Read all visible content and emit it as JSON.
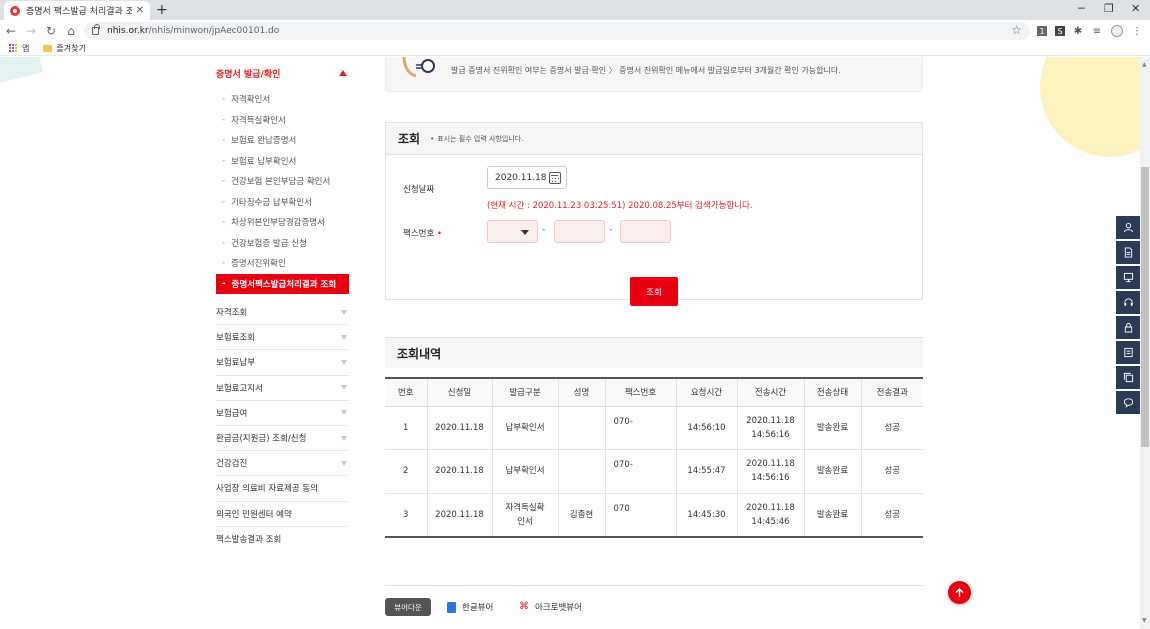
{
  "browser": {
    "tab_title": "증명서 팩스발급 처리결과 조회",
    "url_domain": "nhis.or.kr",
    "url_path": "/nhis/minwon/jpAec00101.do",
    "bookmarks": [
      {
        "label": "앱"
      },
      {
        "label": "즐겨찾기"
      }
    ]
  },
  "sidebar": {
    "active_section": "증명서 발급/확인",
    "sub_items": [
      {
        "label": "자격확인서",
        "active": false
      },
      {
        "label": "자격득실확인서",
        "active": false
      },
      {
        "label": "보험료 완납증명서",
        "active": false
      },
      {
        "label": "보험료 납부확인서",
        "active": false
      },
      {
        "label": "건강보험 본인부담금 확인서",
        "active": false
      },
      {
        "label": "기타징수금 납부확인서",
        "active": false
      },
      {
        "label": "차상위본인부담경감증명서",
        "active": false
      },
      {
        "label": "건강보험증 발급 신청",
        "active": false
      },
      {
        "label": "증명서진위확인",
        "active": false
      },
      {
        "label": "증명서팩스발급처리결과 조회",
        "active": true
      }
    ],
    "menu_items": [
      {
        "label": "자격조회"
      },
      {
        "label": "보험료조회"
      },
      {
        "label": "보험료납부"
      },
      {
        "label": "보험료고지서"
      },
      {
        "label": "보험급여"
      },
      {
        "label": "환급금(지원금) 조회/신청"
      },
      {
        "label": "건강검진"
      },
      {
        "label": "사업장 의료비 자료제공 동의"
      },
      {
        "label": "외국인 민원센터 예약"
      },
      {
        "label": "팩스발송결과 조회"
      }
    ]
  },
  "notice": {
    "text": "발급 증명서 진위확인 여부는 증명서 발급·확인 〉 증명서 진위확인 메뉴에서 발급일로부터 3개월간 확인 가능합니다."
  },
  "search": {
    "title": "조회",
    "required_note": "표시는 필수 입력 사항입니다.",
    "required_mark": "•",
    "date_label": "신청날짜",
    "date_value": "2020.11.18",
    "time_note": "(현재 시간 : 2020.11.23 03:25:51) 2020.08.25부터 검색가능합니다.",
    "fax_label": "팩스번호",
    "dash": "-",
    "submit_label": "조회"
  },
  "results": {
    "title": "조회내역",
    "columns": [
      "번호",
      "신청일",
      "발급구분",
      "성명",
      "팩스번호",
      "요청시간",
      "전송시간",
      "전송상태",
      "전송결과"
    ],
    "rows": [
      {
        "no": "1",
        "date": "2020.11.18",
        "type": "납부확인서",
        "name": "",
        "fax": "070-",
        "req_time": "14:56:10",
        "send_date": "2020.11.18",
        "send_time": "14:56:16",
        "status": "발송완료",
        "result": "성공"
      },
      {
        "no": "2",
        "date": "2020.11.18",
        "type": "납부확인서",
        "name": "",
        "fax": "070-",
        "req_time": "14:55:47",
        "send_date": "2020.11.18",
        "send_time": "14:56:16",
        "status": "발송완료",
        "result": "성공"
      },
      {
        "no": "3",
        "date": "2020.11.18",
        "type": "자격득실확인서",
        "name": "김종현",
        "fax": "070",
        "req_time": "14:45:30",
        "send_date": "2020.11.18",
        "send_time": "14:45:46",
        "status": "발송완료",
        "result": "성공"
      }
    ]
  },
  "viewer": {
    "label": "뷰어다운",
    "hwp_label": "한글뷰어",
    "pdf_label": "아크로뱃뷰어"
  },
  "quick_menu": [
    "user-icon",
    "document-icon",
    "monitor-icon",
    "headset-icon",
    "lock-icon",
    "list-icon",
    "copy-icon",
    "chat-icon"
  ],
  "colors": {
    "accent": "#e60012",
    "quick_menu_bg": "#2b3a57"
  }
}
